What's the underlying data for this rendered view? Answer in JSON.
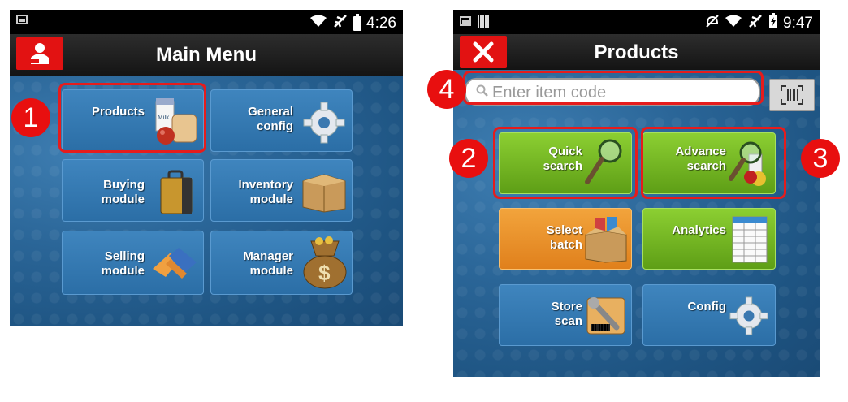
{
  "left": {
    "status": {
      "time": "4:26"
    },
    "title": "Main Menu",
    "tiles": [
      {
        "label": "Products",
        "icon": "groceries-icon"
      },
      {
        "label": "General config",
        "icon": "gear-icon"
      },
      {
        "label": "Buying module",
        "icon": "briefcase-icon"
      },
      {
        "label": "Inventory module",
        "icon": "box-icon"
      },
      {
        "label": "Selling module",
        "icon": "handshake-icon"
      },
      {
        "label": "Manager module",
        "icon": "money-bag-icon"
      }
    ],
    "badge": "1"
  },
  "right": {
    "status": {
      "time": "9:47"
    },
    "title": "Products",
    "search": {
      "placeholder": "Enter item code",
      "value": ""
    },
    "tiles": [
      {
        "label": "Quick search",
        "icon": "magnifier-icon",
        "color": "green"
      },
      {
        "label": "Advance search",
        "icon": "magnifier-products-icon",
        "color": "green"
      },
      {
        "label": "Select batch",
        "icon": "box-of-goods-icon",
        "color": "orange"
      },
      {
        "label": "Analytics",
        "icon": "spreadsheet-icon",
        "color": "green"
      },
      {
        "label": "Store scan",
        "icon": "wrench-barcode-icon",
        "color": "blue"
      },
      {
        "label": "Config",
        "icon": "gear-icon",
        "color": "blue"
      }
    ],
    "badges": [
      "2",
      "3",
      "4"
    ]
  },
  "colors": {
    "highlight": "#e61c1c",
    "badge": "#e80f0f",
    "tile_blue": "#2b6ea6",
    "tile_green": "#6fb321",
    "tile_orange": "#e8901f"
  }
}
